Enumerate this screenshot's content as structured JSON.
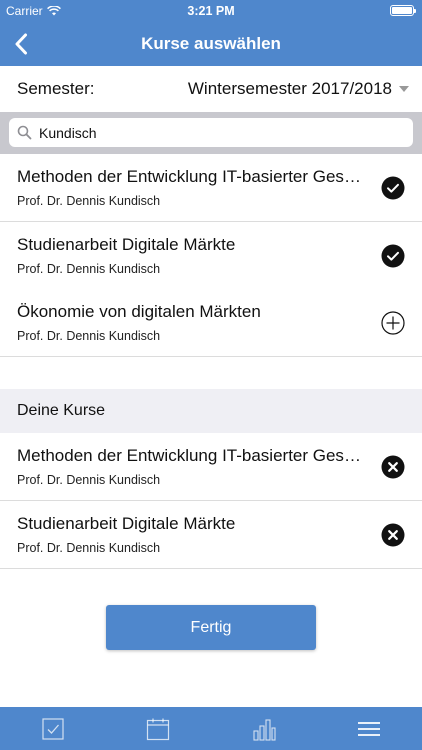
{
  "status": {
    "carrier": "Carrier",
    "time": "3:21 PM"
  },
  "nav": {
    "title": "Kurse auswählen"
  },
  "semester": {
    "label": "Semester:",
    "value": "Wintersemester 2017/2018"
  },
  "search": {
    "value": "Kundisch",
    "icon": "search-icon"
  },
  "results": [
    {
      "title": "Methoden der Entwicklung IT-basierter Geschäftsmodelle",
      "subtitle": "Prof. Dr. Dennis Kundisch",
      "state": "selected"
    },
    {
      "title": "Studienarbeit Digitale Märkte",
      "subtitle": "Prof. Dr. Dennis Kundisch",
      "state": "selected"
    },
    {
      "title": "Ökonomie von digitalen Märkten",
      "subtitle": "Prof. Dr. Dennis Kundisch",
      "state": "add"
    }
  ],
  "my_courses": {
    "header": "Deine Kurse",
    "items": [
      {
        "title": "Methoden der Entwicklung IT-basierter Geschäftsmodelle",
        "subtitle": "Prof. Dr. Dennis Kundisch",
        "state": "remove"
      },
      {
        "title": "Studienarbeit Digitale Märkte",
        "subtitle": "Prof. Dr. Dennis Kundisch",
        "state": "remove"
      }
    ]
  },
  "done_button": {
    "label": "Fertig"
  },
  "tabs": [
    {
      "name": "tab-courses",
      "icon": "checkbox-icon"
    },
    {
      "name": "tab-calendar",
      "icon": "calendar-icon"
    },
    {
      "name": "tab-statistics",
      "icon": "bar-chart-icon"
    },
    {
      "name": "tab-menu",
      "icon": "menu-icon"
    }
  ],
  "colors": {
    "primary": "#4f87cc",
    "section_bg": "#efeff4",
    "search_bg": "#c8c8ce"
  }
}
